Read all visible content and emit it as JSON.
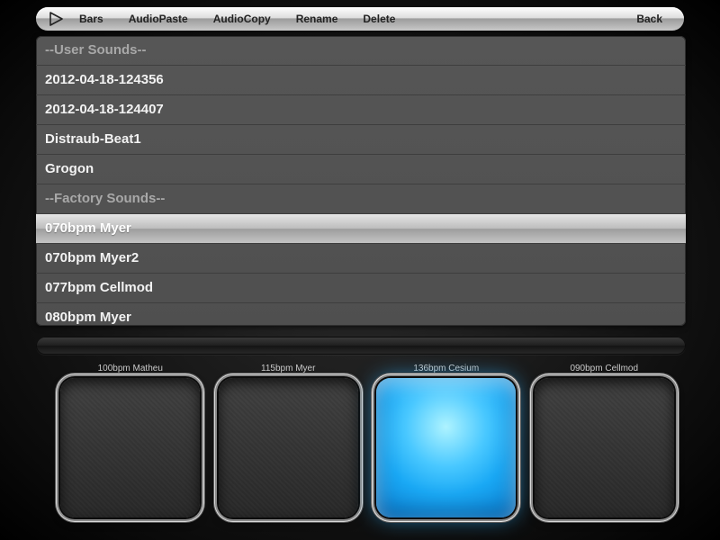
{
  "toolbar": {
    "bars": "Bars",
    "audio_paste": "AudioPaste",
    "audio_copy": "AudioCopy",
    "rename": "Rename",
    "delete": "Delete",
    "back": "Back"
  },
  "list": {
    "user_header": "--User Sounds--",
    "factory_header": "--Factory Sounds--",
    "user_items": [
      "2012-04-18-124356",
      "2012-04-18-124407",
      "Distraub-Beat1",
      "Grogon"
    ],
    "factory_items": [
      "070bpm Myer",
      "070bpm Myer2",
      "077bpm Cellmod",
      "080bpm Myer"
    ],
    "selected": "070bpm Myer"
  },
  "pads": [
    {
      "label": "100bpm Matheu",
      "active": false
    },
    {
      "label": "115bpm Myer",
      "active": false
    },
    {
      "label": "136bpm Cesium",
      "active": true
    },
    {
      "label": "090bpm Cellmod",
      "active": false
    }
  ]
}
